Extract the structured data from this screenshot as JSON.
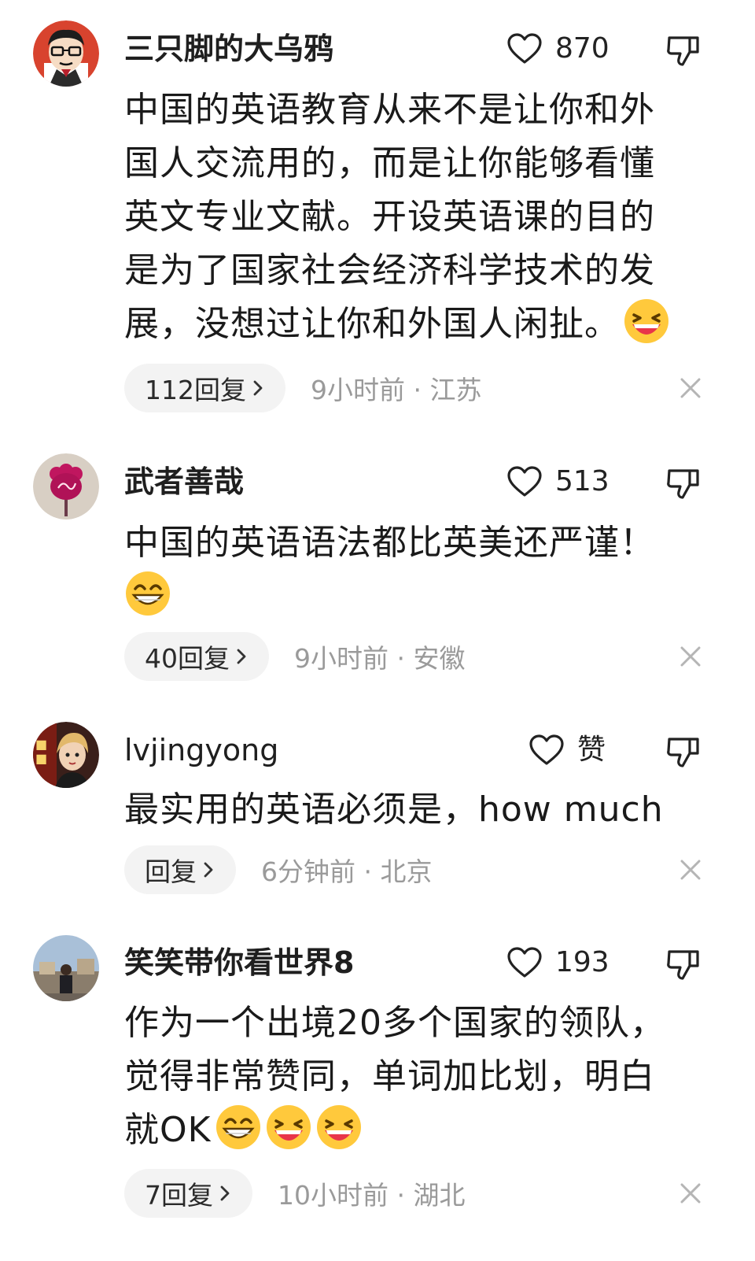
{
  "comments": [
    {
      "username": "三只脚的大乌鸦",
      "likes": "870",
      "content_lines": [
        "中国的英语教育从来不是让你和外",
        "国人交流用的，而是让你能够看懂",
        "英文专业文献。开设英语课的目的",
        "是为了国家社会经济科学技术的发",
        "展，没想过让你和外国人闲扯。"
      ],
      "emojis": [
        "laughing-emoji"
      ],
      "reply_label": "112回复",
      "meta": "9小时前 · 江苏",
      "avatar_icon": "cartoon-man-glasses-avatar"
    },
    {
      "username": "武者善哉",
      "likes": "513",
      "content_lines": [
        "中国的英语语法都比英美还严谨！"
      ],
      "emojis": [
        "grinning-emoji"
      ],
      "reply_label": "40回复",
      "meta": "9小时前 · 安徽",
      "avatar_icon": "magenta-flower-avatar"
    },
    {
      "username": "lvjingyong",
      "likes": "赞",
      "content_lines": [
        "最实用的英语必须是，how much"
      ],
      "emojis": [],
      "reply_label": "回复",
      "meta": "6分钟前 · 北京",
      "avatar_icon": "game-character-avatar"
    },
    {
      "username": "笑笑带你看世界8",
      "likes": "193",
      "content_lines": [
        "作为一个出境20多个国家的领队，",
        "觉得非常赞同，单词加比划，明白",
        "就OK"
      ],
      "emojis": [
        "grinning-emoji",
        "laughing-emoji",
        "laughing-emoji"
      ],
      "reply_label": "7回复",
      "meta": "10小时前 · 湖北",
      "avatar_icon": "outdoor-photo-avatar"
    }
  ],
  "colors": {
    "text": "#1a1a1a",
    "meta": "#9a9a9a",
    "pill_bg": "#f3f3f3",
    "emoji_yellow": "#ffc93c",
    "emoji_mouth": "#e8354a"
  }
}
